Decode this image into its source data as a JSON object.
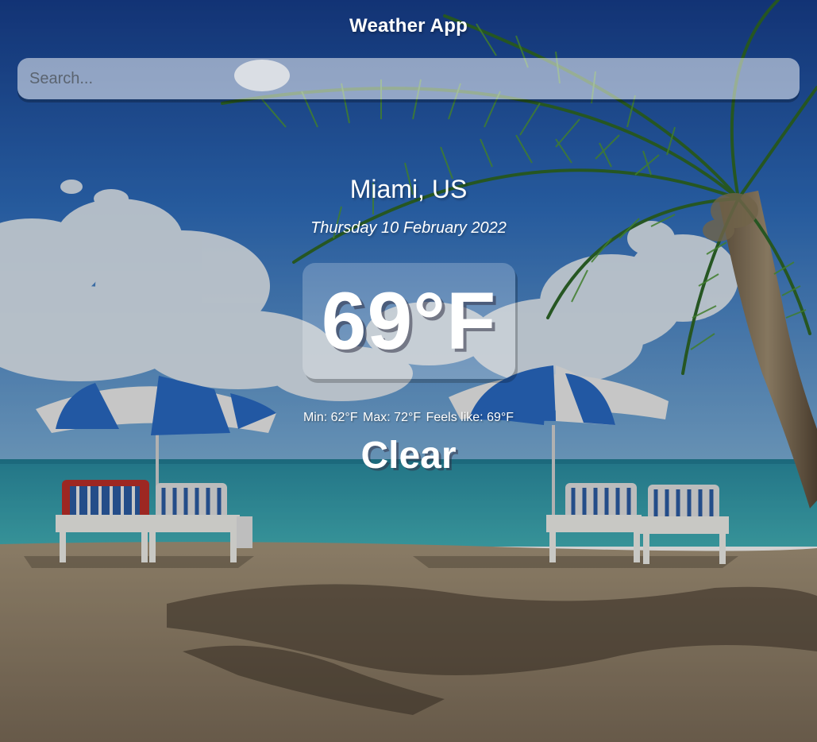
{
  "app": {
    "title": "Weather App"
  },
  "search": {
    "placeholder": "Search...",
    "value": ""
  },
  "location": {
    "name": "Miami, US",
    "date": "Thursday 10 February 2022"
  },
  "weather": {
    "temperature": "69°F",
    "min": "Min: 62°F",
    "max": "Max: 72°F",
    "feels_like": "Feels like: 69°F",
    "condition": "Clear"
  },
  "background": {
    "description_icon": "beach-scene",
    "colors": {
      "sky_top": "#1b4fa8",
      "sky_bottom": "#6fa8dd",
      "sea": "#2c9cad",
      "sand": "#9c8a73",
      "umbrella_blue": "#2a6cc7"
    }
  }
}
